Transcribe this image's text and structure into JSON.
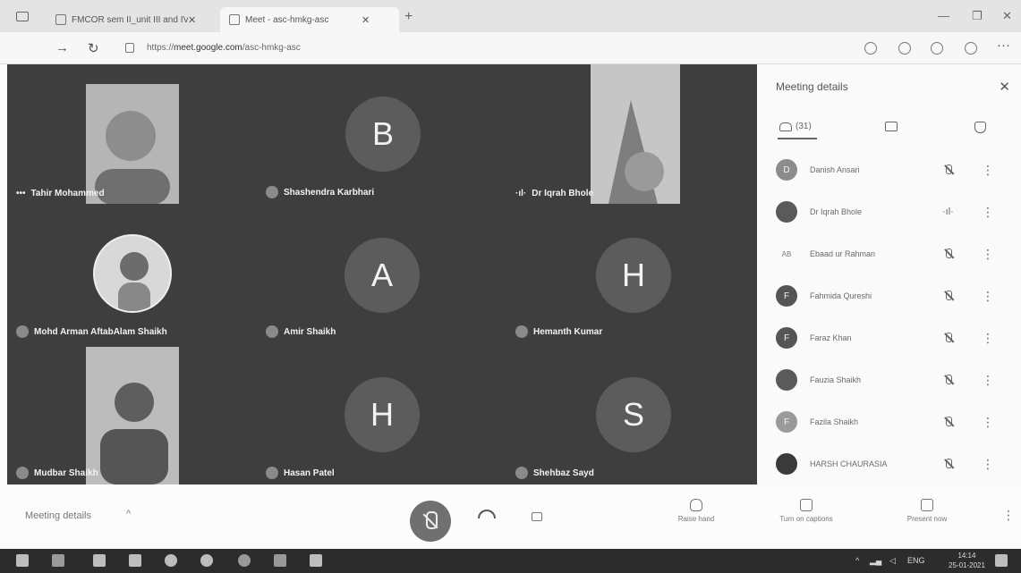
{
  "browser": {
    "tabs": [
      {
        "title": "FMCOR sem II_unit III and IV_Co..."
      },
      {
        "title": "Meet - asc-hmkg-asc"
      }
    ],
    "url_prefix": "https://",
    "url_host": "meet.google.com",
    "url_path": "/asc-hmkg-asc"
  },
  "participants_grid": [
    {
      "name": "Tahir Mohammed",
      "kind": "video",
      "audio": "speaking-dots",
      "dots": "•••"
    },
    {
      "name": "Shashendra Karbhari",
      "kind": "letter",
      "letter": "B",
      "audio": "muted"
    },
    {
      "name": "Dr Iqrah Bhole",
      "kind": "video",
      "audio": "speaking",
      "wave": "·ıl·"
    },
    {
      "name": "Mohd Arman AftabAlam Shaikh",
      "kind": "photo",
      "audio": "muted"
    },
    {
      "name": "Amir Shaikh",
      "kind": "letter",
      "letter": "A",
      "audio": "muted"
    },
    {
      "name": "Hemanth Kumar",
      "kind": "letter",
      "letter": "H",
      "audio": "muted"
    },
    {
      "name": "Mudbar Shaikh",
      "kind": "video",
      "audio": "muted"
    },
    {
      "name": "Hasan Patel",
      "kind": "letter",
      "letter": "H",
      "audio": "muted"
    },
    {
      "name": "Shehbaz Sayd",
      "kind": "letter",
      "letter": "S",
      "audio": "muted"
    }
  ],
  "panel": {
    "title": "Meeting details",
    "close": "✕",
    "people_tab_count": "(31)",
    "people": [
      {
        "initial": "D",
        "name": "Danish Ansari",
        "audio": "muted"
      },
      {
        "initial": "",
        "name": "Dr Iqrah Bhole",
        "audio": "speaking"
      },
      {
        "initial": "AB",
        "name": "Ebaad ur Rahman",
        "audio": "muted"
      },
      {
        "initial": "F",
        "name": "Fahmida Qureshi",
        "audio": "muted"
      },
      {
        "initial": "F",
        "name": "Faraz Khan",
        "audio": "muted"
      },
      {
        "initial": "",
        "name": "Fauzia Shaikh",
        "audio": "muted"
      },
      {
        "initial": "F",
        "name": "Fazila Shaikh",
        "audio": "muted"
      },
      {
        "initial": "",
        "name": "HARSH CHAURASIA",
        "audio": "muted"
      }
    ]
  },
  "bottom_bar": {
    "meeting_details": "Meeting details",
    "chevron": "^",
    "raise_hand": "Raise hand",
    "captions": "Turn on captions",
    "present": "Present now",
    "more": "⋮"
  },
  "taskbar": {
    "lang": "ENG",
    "time": "14:14",
    "date": "25-01-2021"
  }
}
